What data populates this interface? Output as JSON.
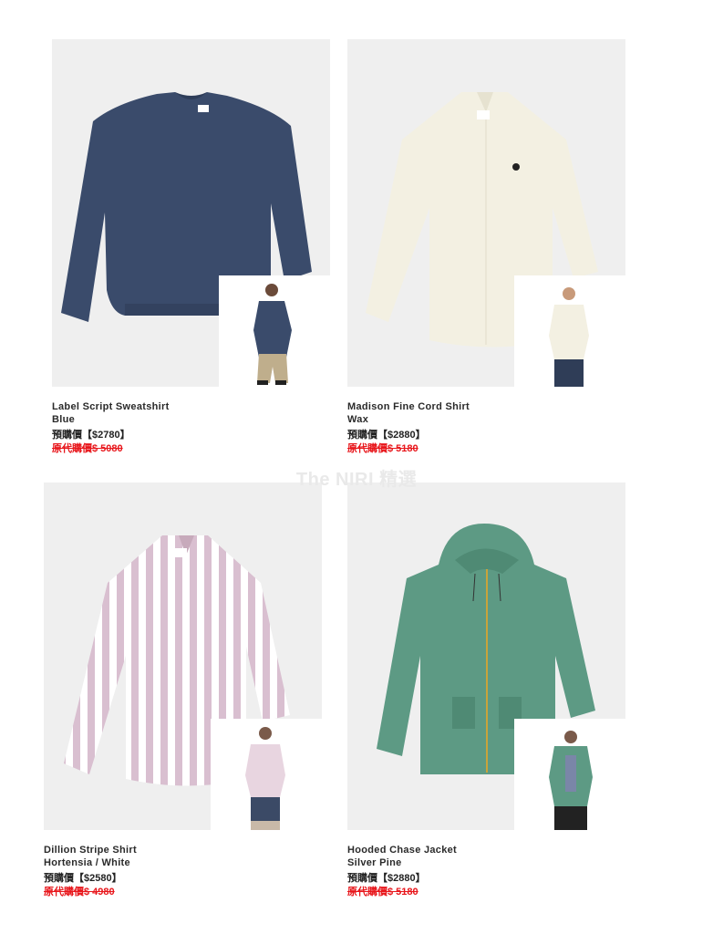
{
  "watermark": "The NIRI 精選",
  "products": [
    {
      "name": "Label Script Sweatshirt",
      "color": "Blue",
      "price": "預購價【$2780】",
      "original_price": "原代購價$ 5080",
      "garment_color": "#3a4b6b"
    },
    {
      "name": "Madison Fine Cord Shirt",
      "color": "Wax",
      "price": "預購價【$2880】",
      "original_price": "原代購價$ 5180",
      "garment_color": "#f3f0e2"
    },
    {
      "name": "Dillion Stripe Shirt",
      "color": "Hortensia / White",
      "price": "預購價【$2580】",
      "original_price": "原代購價$ 4980",
      "garment_color": "#d9bfd0"
    },
    {
      "name": "Hooded Chase Jacket",
      "color": "Silver Pine",
      "price": "預購價【$2880】",
      "original_price": "原代購價$ 5180",
      "garment_color": "#5d9a84"
    }
  ]
}
